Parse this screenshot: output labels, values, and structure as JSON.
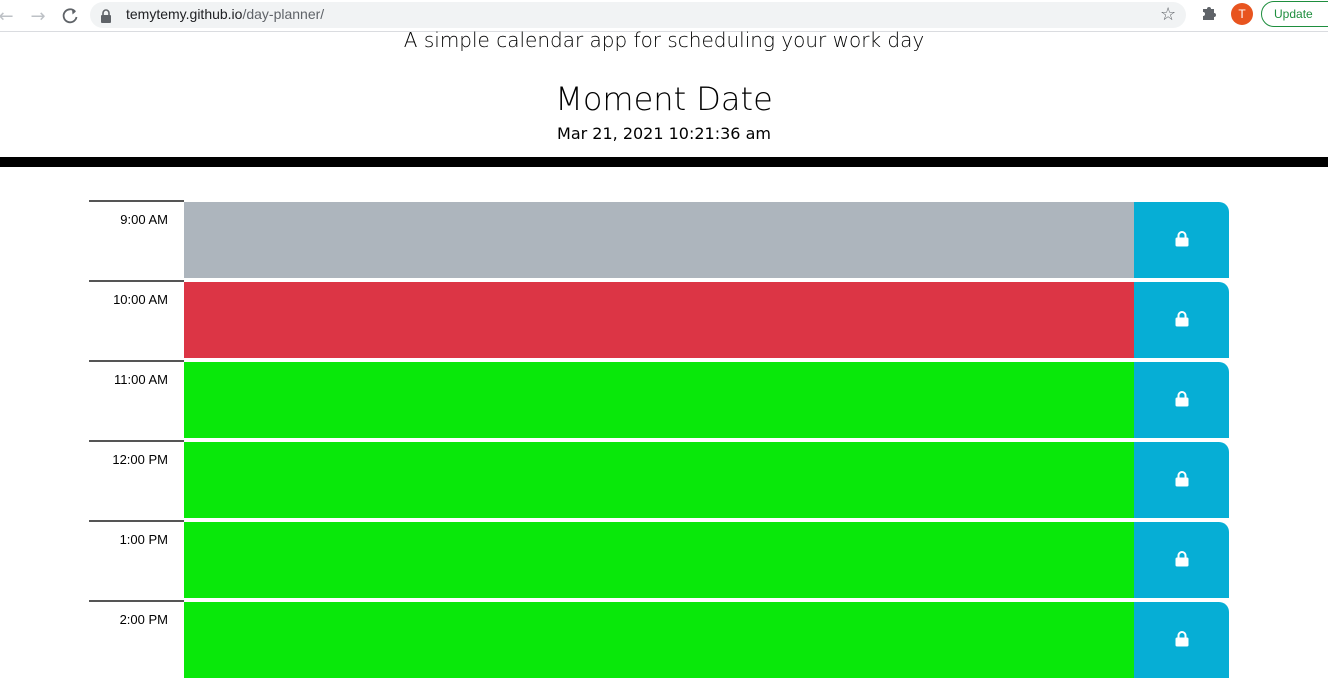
{
  "browser": {
    "url_domain": "temytemy.github.io",
    "url_path": "/day-planner/",
    "avatar_letter": "T",
    "update_label": "Update"
  },
  "header": {
    "lead": "A simple calendar app for scheduling your work day",
    "title": "Moment Date",
    "current_datetime": "Mar 21, 2021 10:21:36 am"
  },
  "colors": {
    "past": "#adb5bd",
    "present": "#dc3545",
    "future": "#09e80a",
    "save": "#06aed5"
  },
  "time_blocks": [
    {
      "hour": "9:00 AM",
      "state": "past",
      "text": "",
      "save_icon": "lock-icon"
    },
    {
      "hour": "10:00 AM",
      "state": "present",
      "text": "",
      "save_icon": "lock-icon"
    },
    {
      "hour": "11:00 AM",
      "state": "future",
      "text": "",
      "save_icon": "lock-icon"
    },
    {
      "hour": "12:00 PM",
      "state": "future",
      "text": "",
      "save_icon": "lock-icon"
    },
    {
      "hour": "1:00 PM",
      "state": "future",
      "text": "",
      "save_icon": "lock-icon"
    },
    {
      "hour": "2:00 PM",
      "state": "future",
      "text": "",
      "save_icon": "lock-icon"
    }
  ]
}
